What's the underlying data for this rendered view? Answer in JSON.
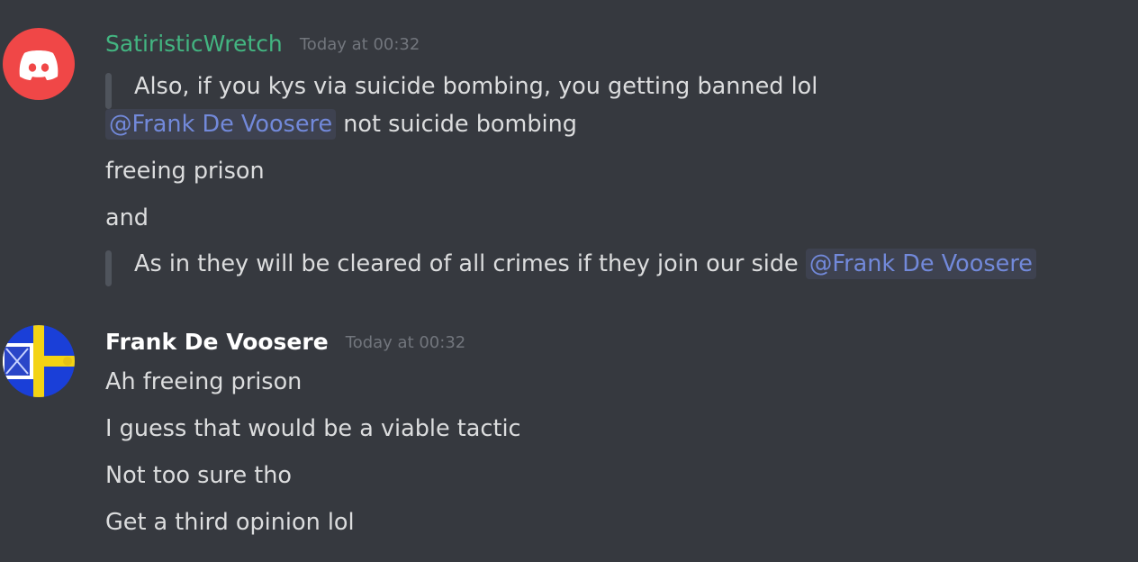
{
  "messages": [
    {
      "author": "SatiristicWretch",
      "author_color": "#43b581",
      "timestamp": "Today at 00:32",
      "avatar_icon": "discord-logo-icon",
      "quote1": "Also, if you kys via suicide bombing, you getting banned lol",
      "line1_mention": "@Frank De Voosere",
      "line1_text": " not suicide bombing",
      "line2": "freeing prison",
      "line3": "and",
      "quote2_text": "As in they will be cleared of all crimes if they join our side ",
      "quote2_mention": "@Frank De Voosere"
    },
    {
      "author": "Frank De Voosere",
      "author_color": "#ffffff",
      "timestamp": "Today at 00:32",
      "avatar_icon": "flag-avatar-icon",
      "lines": [
        "Ah freeing prison",
        "I guess that would be a viable tactic",
        "Not too sure tho",
        "Get a third opinion lol"
      ]
    }
  ]
}
